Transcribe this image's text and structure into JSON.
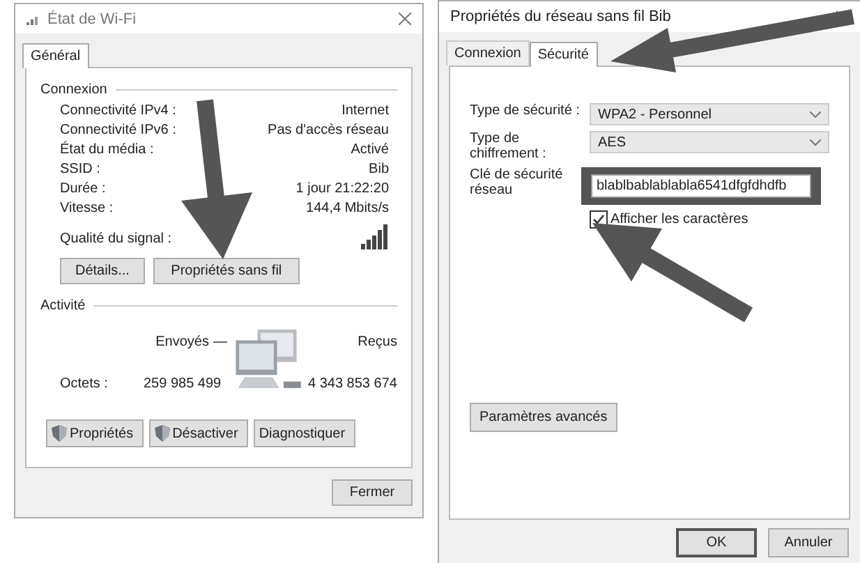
{
  "wifi_status": {
    "title": "État de Wi-Fi",
    "tabs": [
      {
        "label": "Général",
        "selected": true
      }
    ],
    "connection": {
      "heading": "Connexion",
      "rows": [
        {
          "label": "Connectivité IPv4 :",
          "value": "Internet"
        },
        {
          "label": "Connectivité IPv6 :",
          "value": "Pas d'accès réseau"
        },
        {
          "label": "État du média :",
          "value": "Activé"
        },
        {
          "label": "SSID :",
          "value": "Bib"
        },
        {
          "label": "Durée :",
          "value": "1 jour 21:22:20"
        },
        {
          "label": "Vitesse :",
          "value": "144,4 Mbits/s"
        }
      ],
      "signal_label": "Qualité du signal :"
    },
    "buttons": [
      "Détails...",
      "Propriétés sans fil"
    ],
    "activity": {
      "heading": "Activité",
      "sent_label": "Envoyés",
      "received_label": "Reçus",
      "bytes_label": "Octets :",
      "sent": "259 985 499",
      "received": "4 343 853 674"
    },
    "action_buttons": [
      {
        "label": "Propriétés",
        "kind": "shield"
      },
      {
        "label": "Désactiver",
        "kind": "shield"
      },
      {
        "label": "Diagnostiquer",
        "kind": "plain"
      }
    ],
    "close_button": "Fermer"
  },
  "network_properties": {
    "title": "Propriétés du réseau sans fil Bib",
    "tabs": [
      {
        "label": "Connexion",
        "selected": false
      },
      {
        "label": "Sécurité",
        "selected": true
      }
    ],
    "security_type": {
      "label": "Type de sécurité :",
      "value": "WPA2 - Personnel"
    },
    "encryption_type": {
      "label": "Type de chiffrement :",
      "value": "AES"
    },
    "key": {
      "label": "Clé de sécurité réseau",
      "value": "blablbablablabla6541dfgfdhdfb"
    },
    "show_characters": {
      "label": "Afficher les caractères",
      "checked": true
    },
    "advanced_button": "Paramètres avancés",
    "buttons": [
      {
        "label": "OK",
        "default": true
      },
      {
        "label": "Annuler",
        "default": false
      }
    ]
  }
}
